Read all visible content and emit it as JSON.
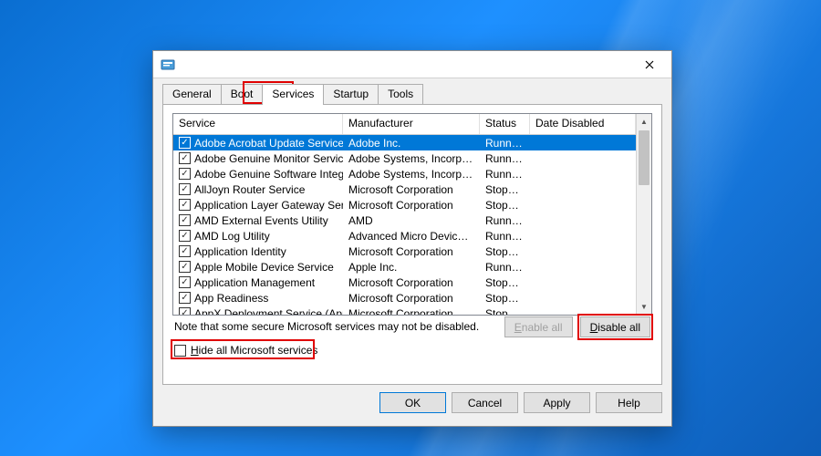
{
  "tabs": {
    "general": "General",
    "boot": "Boot",
    "services": "Services",
    "startup": "Startup",
    "tools": "Tools"
  },
  "columns": {
    "service": "Service",
    "manufacturer": "Manufacturer",
    "status": "Status",
    "date_disabled": "Date Disabled"
  },
  "rows": [
    {
      "svc": "Adobe Acrobat Update Service",
      "mfr": "Adobe Inc.",
      "status": "Running",
      "checked": true,
      "selected": true
    },
    {
      "svc": "Adobe Genuine Monitor Service",
      "mfr": "Adobe Systems, Incorpora...",
      "status": "Running",
      "checked": true
    },
    {
      "svc": "Adobe Genuine Software Integri...",
      "mfr": "Adobe Systems, Incorpora...",
      "status": "Running",
      "checked": true
    },
    {
      "svc": "AllJoyn Router Service",
      "mfr": "Microsoft Corporation",
      "status": "Stopped",
      "checked": true
    },
    {
      "svc": "Application Layer Gateway Service",
      "mfr": "Microsoft Corporation",
      "status": "Stopped",
      "checked": true
    },
    {
      "svc": "AMD External Events Utility",
      "mfr": "AMD",
      "status": "Running",
      "checked": true
    },
    {
      "svc": "AMD Log Utility",
      "mfr": "Advanced Micro Devices, I...",
      "status": "Running",
      "checked": true
    },
    {
      "svc": "Application Identity",
      "mfr": "Microsoft Corporation",
      "status": "Stopped",
      "checked": true
    },
    {
      "svc": "Apple Mobile Device Service",
      "mfr": "Apple Inc.",
      "status": "Running",
      "checked": true
    },
    {
      "svc": "Application Management",
      "mfr": "Microsoft Corporation",
      "status": "Stopped",
      "checked": true
    },
    {
      "svc": "App Readiness",
      "mfr": "Microsoft Corporation",
      "status": "Stopped",
      "checked": true
    },
    {
      "svc": "AppX Deployment Service (AppX...",
      "mfr": "Microsoft Corporation",
      "status": "Stopped",
      "checked": true
    }
  ],
  "note": "Note that some secure Microsoft services may not be disabled.",
  "buttons": {
    "enable_all_prefix": "E",
    "enable_all_rest": "nable all",
    "disable_all_prefix": "D",
    "disable_all_rest": "isable all",
    "ok": "OK",
    "cancel": "Cancel",
    "apply": "Apply",
    "help": "Help"
  },
  "hide_checkbox": {
    "prefix": "H",
    "rest": "ide all Microsoft services",
    "checked": false
  }
}
